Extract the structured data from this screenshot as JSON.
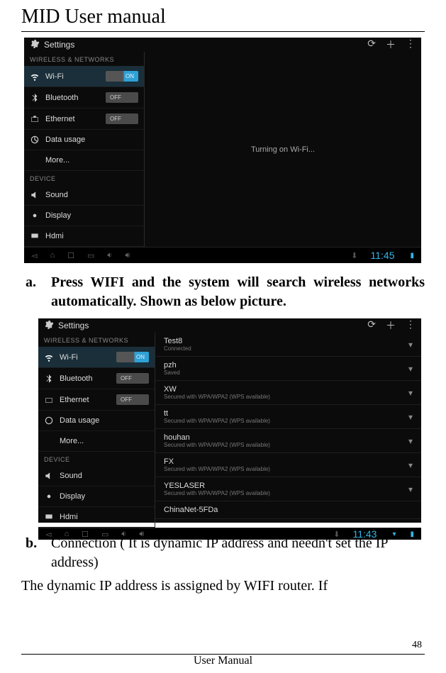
{
  "header": {
    "title": "MID User manual"
  },
  "screenshot1": {
    "title": "Settings",
    "section1": "WIRELESS & NETWORKS",
    "section2": "DEVICE",
    "rows": {
      "wifi": {
        "label": "Wi-Fi",
        "toggle": "ON"
      },
      "bluetooth": {
        "label": "Bluetooth",
        "toggle": "OFF"
      },
      "ethernet": {
        "label": "Ethernet",
        "toggle": "OFF"
      },
      "datausage": {
        "label": "Data usage"
      },
      "more": {
        "label": "More..."
      },
      "sound": {
        "label": "Sound"
      },
      "display": {
        "label": "Display"
      },
      "hdmi": {
        "label": "Hdmi"
      }
    },
    "main_text": "Turning on Wi-Fi...",
    "clock": "11:45"
  },
  "screenshot2": {
    "title": "Settings",
    "section1": "WIRELESS & NETWORKS",
    "section2": "DEVICE",
    "rows": {
      "wifi": {
        "label": "Wi-Fi",
        "toggle": "ON"
      },
      "bluetooth": {
        "label": "Bluetooth",
        "toggle": "OFF"
      },
      "ethernet": {
        "label": "Ethernet",
        "toggle": "OFF"
      },
      "datausage": {
        "label": "Data usage"
      },
      "more": {
        "label": "More..."
      },
      "sound": {
        "label": "Sound"
      },
      "display": {
        "label": "Display"
      },
      "hdmi": {
        "label": "Hdmi"
      }
    },
    "networks": [
      {
        "name": "Test8",
        "sub": "Connected"
      },
      {
        "name": "pzh",
        "sub": "Saved"
      },
      {
        "name": "XW",
        "sub": "Secured with WPA/WPA2 (WPS available)"
      },
      {
        "name": "tt",
        "sub": "Secured with WPA/WPA2 (WPS available)"
      },
      {
        "name": "houhan",
        "sub": "Secured with WPA/WPA2 (WPS available)"
      },
      {
        "name": "FX",
        "sub": "Secured with WPA/WPA2 (WPS available)"
      },
      {
        "name": "YESLASER",
        "sub": "Secured with WPA/WPA2 (WPS available)"
      },
      {
        "name": "ChinaNet-5FDa",
        "sub": ""
      }
    ],
    "clock": "11:43"
  },
  "doc": {
    "item_a_marker": "a.",
    "item_a_text": "Press WIFI and the system will search wireless networks automatically. Shown as below picture.",
    "item_b_marker": "b.",
    "item_b_text": "Connection ( It is dynamic IP address and needn't set the IP address)",
    "para": "The dynamic IP address is assigned by WIFI router. If"
  },
  "footer": {
    "page": "48",
    "label": "User Manual"
  }
}
